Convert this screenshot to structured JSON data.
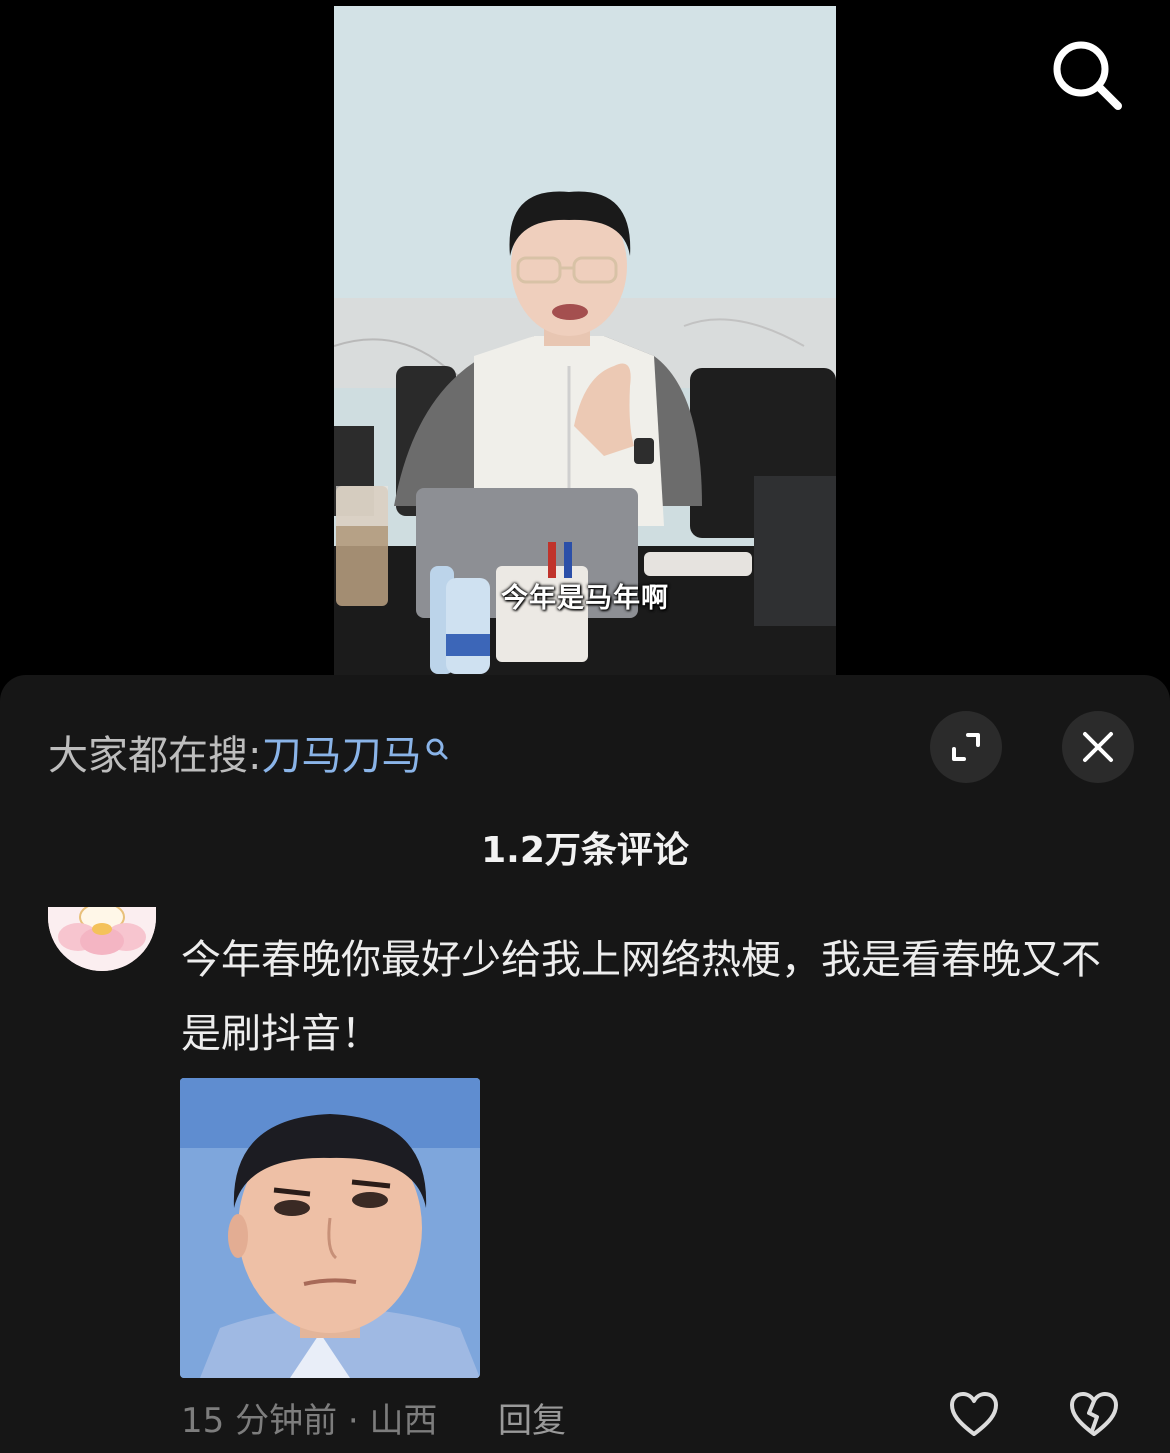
{
  "video": {
    "subtitle": "今年是马年啊",
    "search_icon": "search-icon"
  },
  "panel": {
    "trend_prefix": "大家都在搜:",
    "trend_keyword": "刀马刀马",
    "expand_icon": "expand-icon",
    "close_icon": "close-icon",
    "comment_count": "1.2万条评论"
  },
  "comment": {
    "text": "今年春晚你最好少给我上网络热梗，我是看春晚又不是刷抖音！",
    "meta": "15 分钟前 · 山西",
    "reply_label": "回复",
    "like_icon": "heart-icon",
    "dislike_icon": "broken-heart-icon"
  },
  "colors": {
    "sheet_bg": "#161616",
    "keyword": "#8ab4e8",
    "button_bg": "#2b2b2b"
  }
}
